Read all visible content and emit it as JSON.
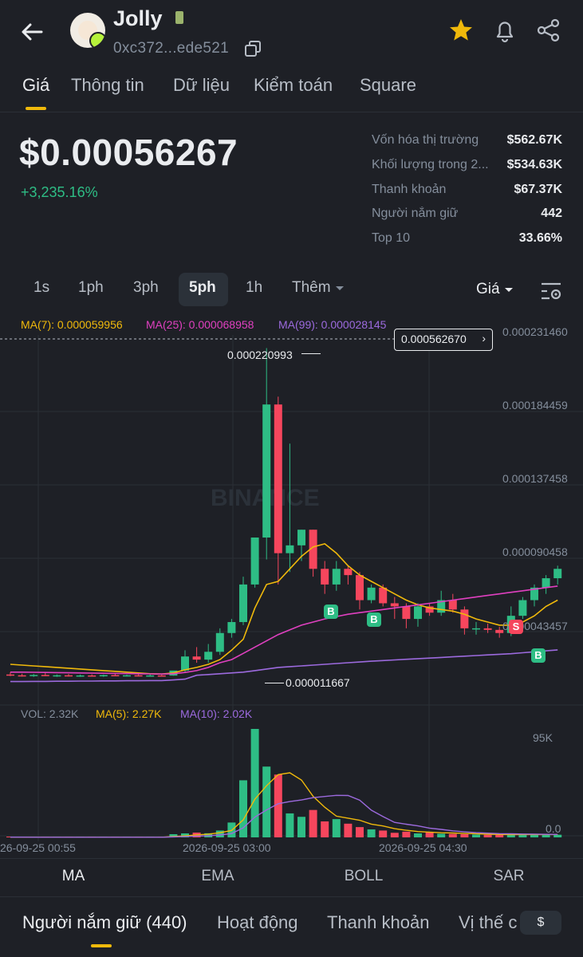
{
  "header": {
    "name": "Jolly",
    "address": "0xc372...ede521"
  },
  "tabs": [
    {
      "label": "Giá",
      "active": true
    },
    {
      "label": "Thông tin"
    },
    {
      "label": "Dữ liệu"
    },
    {
      "label": "Kiểm toán"
    },
    {
      "label": "Square"
    }
  ],
  "price": {
    "value": "$0.00056267",
    "change": "+3,235.16%"
  },
  "stats": [
    {
      "label": "Vốn hóa thị trường",
      "value": "$562.67K"
    },
    {
      "label": "Khối lượng trong 2...",
      "value": "$534.63K"
    },
    {
      "label": "Thanh khoản",
      "value": "$67.37K"
    },
    {
      "label": "Người nắm giữ",
      "value": "442"
    },
    {
      "label": "Top 10",
      "value": "33.66%"
    }
  ],
  "intervals": [
    "1s",
    "1ph",
    "3ph",
    "5ph",
    "1h"
  ],
  "interval_active": "5ph",
  "interval_more": "Thêm",
  "price_toggle": "Giá",
  "ma_legend": {
    "ma7": "MA(7): 0.000059956",
    "ma25": "MA(25): 0.000068958",
    "ma99": "MA(99): 0.000028145"
  },
  "vol_legend": {
    "vol": "VOL: 2.32K",
    "ma5": "MA(5): 2.27K",
    "ma10": "MA(10): 2.02K"
  },
  "chart_data": {
    "type": "candlestick",
    "price_axis_labels": [
      "0.000231460",
      "0.000184459",
      "0.000137458",
      "0.000090458",
      "0.000043457"
    ],
    "current_price_label": "0.000562670",
    "high_label": "0.000220993",
    "low_label": "0.000011667",
    "volume_axis_labels": [
      "95K",
      "0.0"
    ],
    "time_labels": [
      "26-09-25 00:55",
      "2026-09-25 03:00",
      "2026-09-25 04:30"
    ],
    "watermark": "BINANCE",
    "markers": [
      "B",
      "B",
      "S",
      "B"
    ],
    "colors": {
      "up": "#2ebd85",
      "down": "#f6465d",
      "ma7": "#f0b90b",
      "ma25": "#e040c0",
      "ma99": "#9c6ade"
    },
    "candles": [
      {
        "o": 1.25e-05,
        "h": 1.4e-05,
        "l": 1.15e-05,
        "c": 1.2e-05
      },
      {
        "o": 1.2e-05,
        "h": 1.3e-05,
        "l": 1.12e-05,
        "c": 1.18e-05
      },
      {
        "o": 1.18e-05,
        "h": 1.28e-05,
        "l": 1.1e-05,
        "c": 1.22e-05
      },
      {
        "o": 1.22e-05,
        "h": 1.35e-05,
        "l": 1.15e-05,
        "c": 1.18e-05
      },
      {
        "o": 1.18e-05,
        "h": 1.25e-05,
        "l": 1.1e-05,
        "c": 1.2e-05
      },
      {
        "o": 1.2e-05,
        "h": 1.28e-05,
        "l": 1.12e-05,
        "c": 1.16e-05
      },
      {
        "o": 1.16e-05,
        "h": 1.24e-05,
        "l": 1.1e-05,
        "c": 1.19e-05
      },
      {
        "o": 1.19e-05,
        "h": 1.26e-05,
        "l": 1.12e-05,
        "c": 1.17e-05
      },
      {
        "o": 1.17e-05,
        "h": 1.25e-05,
        "l": 1.1e-05,
        "c": 1.21e-05
      },
      {
        "o": 1.21e-05,
        "h": 1.3e-05,
        "l": 1.14e-05,
        "c": 1.18e-05
      },
      {
        "o": 1.18e-05,
        "h": 1.24e-05,
        "l": 1.12e-05,
        "c": 1.2e-05
      },
      {
        "o": 1.2e-05,
        "h": 1.27e-05,
        "l": 1.13e-05,
        "c": 1.17e-05
      },
      {
        "o": 1.17e-05,
        "h": 1.25e-05,
        "l": 1.11e-05,
        "c": 1.19e-05
      },
      {
        "o": 1.19e-05,
        "h": 1.26e-05,
        "l": 1.13e-05,
        "c": 1.18e-05
      },
      {
        "o": 1.18e-05,
        "h": 1.3e-05,
        "l": 1.17e-05,
        "c": 1.5e-05
      },
      {
        "o": 1.5e-05,
        "h": 2.8e-05,
        "l": 1.4e-05,
        "c": 2.4e-05
      },
      {
        "o": 2.4e-05,
        "h": 3e-05,
        "l": 2e-05,
        "c": 2.2e-05
      },
      {
        "o": 2.2e-05,
        "h": 3.2e-05,
        "l": 2e-05,
        "c": 2.7e-05
      },
      {
        "o": 2.7e-05,
        "h": 4.2e-05,
        "l": 2.5e-05,
        "c": 3.9e-05
      },
      {
        "o": 3.9e-05,
        "h": 4.8e-05,
        "l": 3.6e-05,
        "c": 4.6e-05
      },
      {
        "o": 4.6e-05,
        "h": 7.5e-05,
        "l": 4.4e-05,
        "c": 7e-05
      },
      {
        "o": 7e-05,
        "h": 9.5e-05,
        "l": 6.8e-05,
        "c": 0.0001
      },
      {
        "o": 0.0001,
        "h": 0.000221,
        "l": 8.6e-05,
        "c": 0.000185
      },
      {
        "o": 0.000185,
        "h": 0.00019,
        "l": 7e-05,
        "c": 9e-05
      },
      {
        "o": 9e-05,
        "h": 0.00016,
        "l": 7.8e-05,
        "c": 9.5e-05
      },
      {
        "o": 9.5e-05,
        "h": 0.000105,
        "l": 8.5e-05,
        "c": 0.000105
      },
      {
        "o": 0.000105,
        "h": 0.000105,
        "l": 7.5e-05,
        "c": 8e-05
      },
      {
        "o": 8e-05,
        "h": 8.5e-05,
        "l": 6.4e-05,
        "c": 7e-05
      },
      {
        "o": 7e-05,
        "h": 8.5e-05,
        "l": 6.6e-05,
        "c": 8e-05
      },
      {
        "o": 8e-05,
        "h": 8.2e-05,
        "l": 7e-05,
        "c": 7.6e-05
      },
      {
        "o": 7.6e-05,
        "h": 7.8e-05,
        "l": 5.4e-05,
        "c": 6e-05
      },
      {
        "o": 6e-05,
        "h": 7e-05,
        "l": 5.8e-05,
        "c": 6.8e-05
      },
      {
        "o": 6.8e-05,
        "h": 7e-05,
        "l": 5.6e-05,
        "c": 5.8e-05
      },
      {
        "o": 5.8e-05,
        "h": 6.2e-05,
        "l": 4.8e-05,
        "c": 5.6e-05
      },
      {
        "o": 5.6e-05,
        "h": 5.8e-05,
        "l": 4.2e-05,
        "c": 4.8e-05
      },
      {
        "o": 4.8e-05,
        "h": 5.8e-05,
        "l": 4.3e-05,
        "c": 5.6e-05
      },
      {
        "o": 5.6e-05,
        "h": 5.8e-05,
        "l": 5e-05,
        "c": 5.2e-05
      },
      {
        "o": 5.2e-05,
        "h": 6.6e-05,
        "l": 5e-05,
        "c": 6e-05
      },
      {
        "o": 6e-05,
        "h": 6.4e-05,
        "l": 5.2e-05,
        "c": 5.4e-05
      },
      {
        "o": 5.4e-05,
        "h": 5.6e-05,
        "l": 3.8e-05,
        "c": 4.2e-05
      },
      {
        "o": 4.2e-05,
        "h": 4.6e-05,
        "l": 3.8e-05,
        "c": 4.2e-05
      },
      {
        "o": 4.2e-05,
        "h": 4.5e-05,
        "l": 3.9e-05,
        "c": 4.1e-05
      },
      {
        "o": 4.1e-05,
        "h": 4.3e-05,
        "l": 3.6e-05,
        "c": 3.9e-05
      },
      {
        "o": 3.9e-05,
        "h": 5.6e-05,
        "l": 3.7e-05,
        "c": 5e-05
      },
      {
        "o": 5e-05,
        "h": 6.2e-05,
        "l": 4.8e-05,
        "c": 6e-05
      },
      {
        "o": 6e-05,
        "h": 7e-05,
        "l": 5.6e-05,
        "c": 6.8e-05
      },
      {
        "o": 6.8e-05,
        "h": 7.6e-05,
        "l": 6.4e-05,
        "c": 7.4e-05
      },
      {
        "o": 7.4e-05,
        "h": 8.2e-05,
        "l": 7e-05,
        "c": 8e-05
      }
    ],
    "volumes": [
      200,
      150,
      120,
      180,
      140,
      110,
      160,
      130,
      150,
      170,
      120,
      140,
      130,
      160,
      2800,
      3500,
      4200,
      3600,
      6000,
      13000,
      50000,
      95000,
      62000,
      55000,
      21000,
      18000,
      24000,
      14000,
      16000,
      12000,
      9000,
      7000,
      6000,
      4000,
      5000,
      3500,
      4500,
      3200,
      3000,
      2800,
      2500,
      2300,
      2200,
      2400,
      3000,
      2600,
      2400,
      2320
    ],
    "ma7": [
      1.9e-05,
      1.85e-05,
      1.8e-05,
      1.75e-05,
      1.7e-05,
      1.65e-05,
      1.6e-05,
      1.55e-05,
      1.5e-05,
      1.45e-05,
      1.4e-05,
      1.35e-05,
      1.3e-05,
      1.28e-05,
      1.35e-05,
      1.55e-05,
      1.7e-05,
      1.9e-05,
      2.2e-05,
      2.8e-05,
      3.5e-05,
      5.5e-05,
      7e-05,
      7.2e-05,
      8e-05,
      8.8e-05,
      9.4e-05,
      9.6e-05,
      9e-05,
      8.2e-05,
      7.6e-05,
      7.2e-05,
      6.8e-05,
      6.4e-05,
      6e-05,
      5.7e-05,
      5.5e-05,
      5.4e-05,
      5.3e-05,
      5.1e-05,
      4.8e-05,
      4.6e-05,
      4.4e-05,
      4.4e-05,
      4.6e-05,
      5e-05,
      5.6e-05,
      6e-05
    ],
    "ma25": [
      1.4e-05,
      1.4e-05,
      1.39e-05,
      1.38e-05,
      1.37e-05,
      1.36e-05,
      1.35e-05,
      1.34e-05,
      1.33e-05,
      1.32e-05,
      1.31e-05,
      1.3e-05,
      1.29e-05,
      1.28e-05,
      1.3e-05,
      1.38e-05,
      1.5e-05,
      1.7e-05,
      2e-05,
      2.2e-05,
      2.6e-05,
      3e-05,
      3.4e-05,
      3.8e-05,
      4.1e-05,
      4.4e-05,
      4.6e-05,
      4.8e-05,
      4.95e-05,
      5.1e-05,
      5.2e-05,
      5.3e-05,
      5.4e-05,
      5.5e-05,
      5.6e-05,
      5.7e-05,
      5.8e-05,
      5.9e-05,
      6e-05,
      6.1e-05,
      6.2e-05,
      6.3e-05,
      6.4e-05,
      6.5e-05,
      6.6e-05,
      6.7e-05,
      6.8e-05,
      6.9e-05
    ],
    "ma99": [
      8e-06,
      8e-06,
      8.1e-06,
      8.1e-06,
      8.2e-06,
      8.2e-06,
      8.3e-06,
      8.3e-06,
      8.4e-06,
      8.4e-06,
      8.5e-06,
      8.5e-06,
      8.6e-06,
      8.6e-06,
      9e-06,
      9.5e-06,
      1.2e-05,
      1.25e-05,
      1.3e-05,
      1.35e-05,
      1.4e-05,
      1.5e-05,
      1.6e-05,
      1.7e-05,
      1.75e-05,
      1.8e-05,
      1.85e-05,
      1.9e-05,
      1.95e-05,
      2e-05,
      2.05e-05,
      2.1e-05,
      2.14e-05,
      2.18e-05,
      2.22e-05,
      2.26e-05,
      2.3e-05,
      2.34e-05,
      2.38e-05,
      2.42e-05,
      2.46e-05,
      2.5e-05,
      2.54e-05,
      2.58e-05,
      2.64e-05,
      2.7e-05,
      2.76e-05,
      2.82e-05
    ]
  },
  "indicator_tabs": [
    "MA",
    "EMA",
    "BOLL",
    "SAR"
  ],
  "indicator_active": "MA",
  "bottom_tabs": [
    {
      "label": "Người nắm giữ (440)",
      "active": true
    },
    {
      "label": "Hoạt động"
    },
    {
      "label": "Thanh khoản"
    },
    {
      "label": "Vị thế c"
    }
  ],
  "currency_label": "$"
}
